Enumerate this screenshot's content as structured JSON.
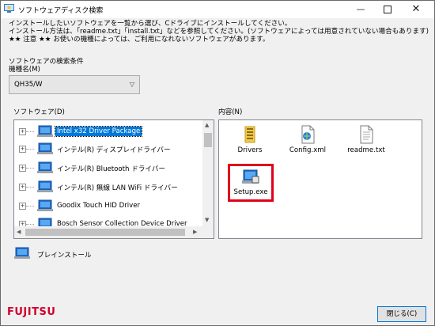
{
  "window": {
    "title": "ソフトウェアディスク検索",
    "minimize": "—",
    "close": "✕"
  },
  "instructions": {
    "line1": "インストールしたいソフトウェアを一覧から選び、Cドライブにインストールしてください。",
    "line2": "インストール方法は、「readme.txt」「install.txt」などを参照してください。(ソフトウェアによっては用意されていない場合もあります)",
    "line3": "★★ 注意 ★★ お使いの機種によっては、ご利用になれないソフトウェアがあります。"
  },
  "search": {
    "section_label": "ソフトウェアの検索条件",
    "model_label": "機種名(M)",
    "model_value": "QH35/W"
  },
  "software_panel": {
    "label": "ソフトウェア(D)",
    "items": [
      {
        "label": "Intel x32 Driver Package",
        "selected": true
      },
      {
        "label": "インテル(R) ディスプレイドライバー",
        "selected": false
      },
      {
        "label": "インテル(R) Bluetooth ドライバー",
        "selected": false
      },
      {
        "label": "インテル(R) 無線 LAN WiFi ドライバー",
        "selected": false
      },
      {
        "label": "Goodix Touch HID Driver",
        "selected": false
      },
      {
        "label": "Bosch Sensor Collection Device Driver",
        "selected": false
      }
    ],
    "expander_symbol": "+"
  },
  "content_panel": {
    "label": "内容(N)",
    "files": [
      {
        "name": "Drivers",
        "icon": "folder-icon"
      },
      {
        "name": "Config.xml",
        "icon": "xml-file-icon"
      },
      {
        "name": "readme.txt",
        "icon": "text-file-icon"
      },
      {
        "name": "Setup.exe",
        "icon": "setup-exe-icon",
        "highlighted": true
      }
    ]
  },
  "preinstall": {
    "label": "プレインストール"
  },
  "footer": {
    "logo_text": "FUJITSU",
    "close_button": "閉じる(C)"
  },
  "colors": {
    "selection": "#0078d7",
    "highlight_frame": "#e0001b",
    "logo": "#d2002d"
  }
}
